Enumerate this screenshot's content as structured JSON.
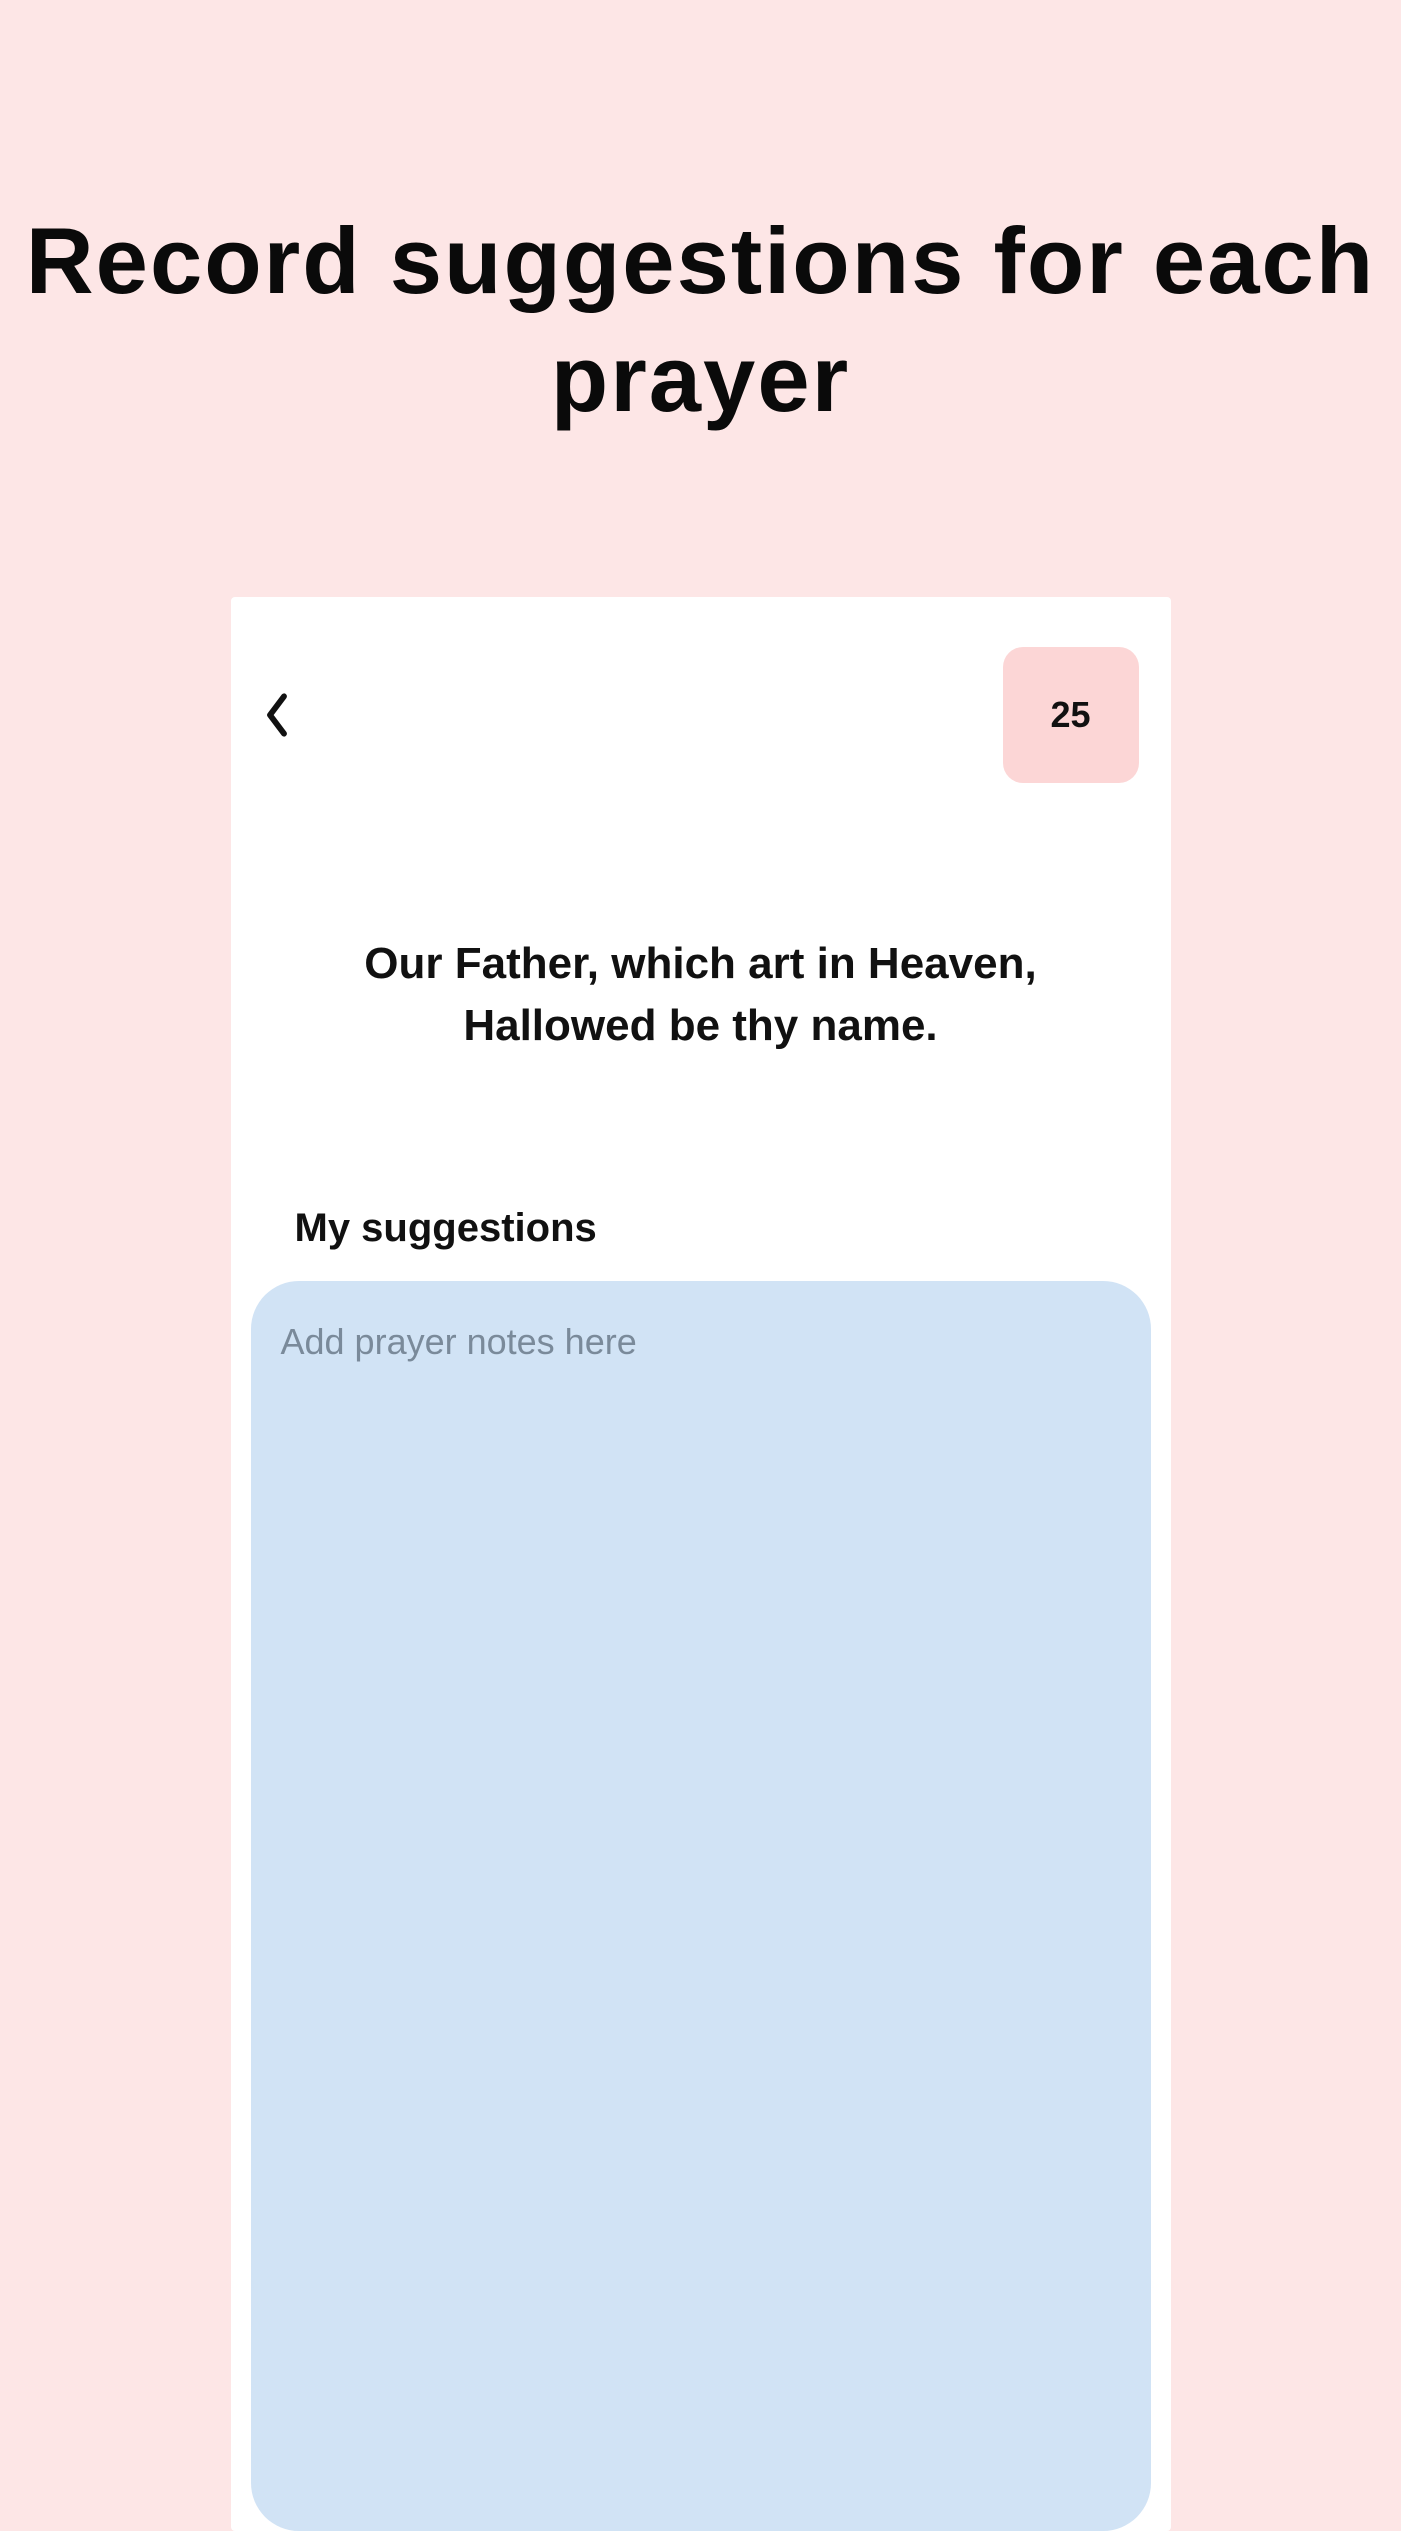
{
  "headline": "Record suggestions for each prayer",
  "header": {
    "badge_count": "25"
  },
  "main": {
    "prayer_text": "Our Father, which art in Heaven, Hallowed be thy name.",
    "suggestions_label": "My suggestions",
    "notes_placeholder": "Add prayer notes here"
  }
}
